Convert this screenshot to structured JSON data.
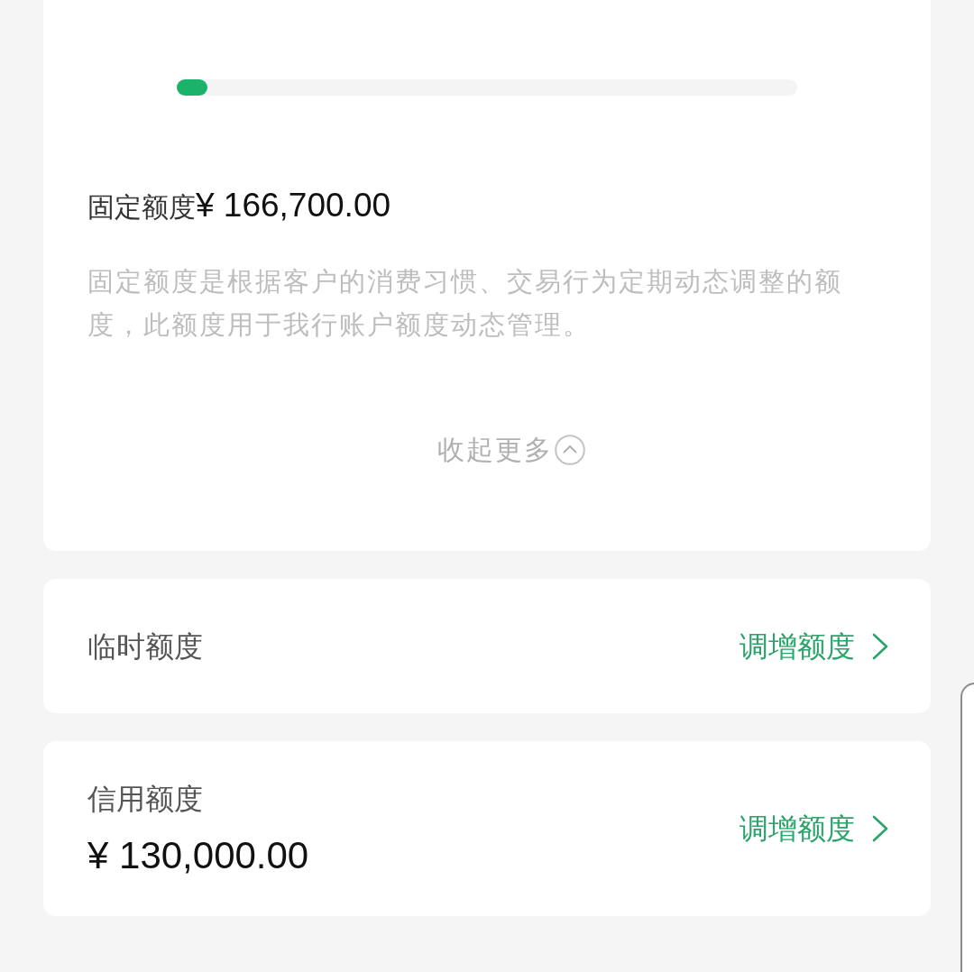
{
  "limit_card": {
    "progress": {
      "level": 0.05
    },
    "fixed_limit": {
      "label": "固定额度",
      "amount": "¥ 166,700.00"
    },
    "description": "固定额度是根据客户的消费习惯、交易行为定期动态调整的额度，此额度用于我行账户额度动态管理。",
    "collapse": {
      "label": "收起更多",
      "expanded": true
    }
  },
  "rows": [
    {
      "kind": "single",
      "label": "临时额度",
      "action": "调增额度"
    },
    {
      "kind": "amount",
      "label": "信用额度",
      "amount": "¥ 130,000.00",
      "action": "调增额度"
    }
  ]
}
